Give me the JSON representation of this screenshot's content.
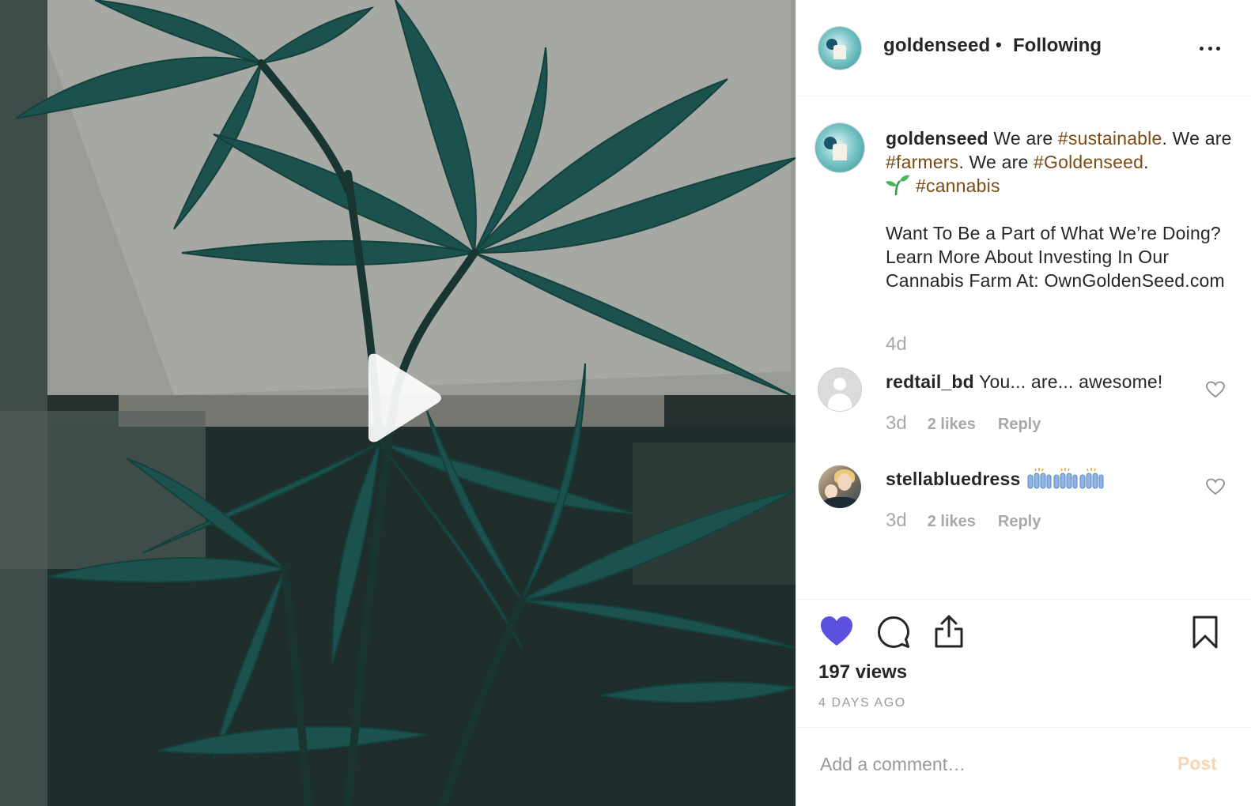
{
  "post": {
    "username": "goldenseed",
    "separator": "•",
    "follow_status": "Following"
  },
  "caption": {
    "username": "goldenseed",
    "parts": {
      "p1": " We are ",
      "tag1": "#sustainable",
      "p2": ". We are ",
      "tag2": "#farmers",
      "p3": ". We are ",
      "tag3": "#Goldenseed",
      "p4": ".",
      "tag4": "#cannabis"
    },
    "sprout_emoji": "seedling",
    "body": "Want To Be a Part of What We’re Doing? Learn More About Investing In Our Cannabis Farm At: OwnGoldenSeed.com",
    "time": "4d"
  },
  "comments": [
    {
      "username": "redtail_bd",
      "text": "You... are... awesome!",
      "time": "3d",
      "likes": "2 likes",
      "reply": "Reply"
    },
    {
      "username": "stellabluedress",
      "text": "",
      "emoji": "raising-hands x3",
      "time": "3d",
      "likes": "2 likes",
      "reply": "Reply"
    }
  ],
  "actions": {
    "liked": true,
    "like_color": "#5b51de",
    "views": "197 views",
    "date": "4 DAYS AGO"
  },
  "add_comment": {
    "placeholder": "Add a comment…",
    "post_label": "Post"
  },
  "colors": {
    "hashtag": "#7a4b14",
    "muted": "#a8a8a8",
    "post_disabled": "#f6d7b4"
  }
}
